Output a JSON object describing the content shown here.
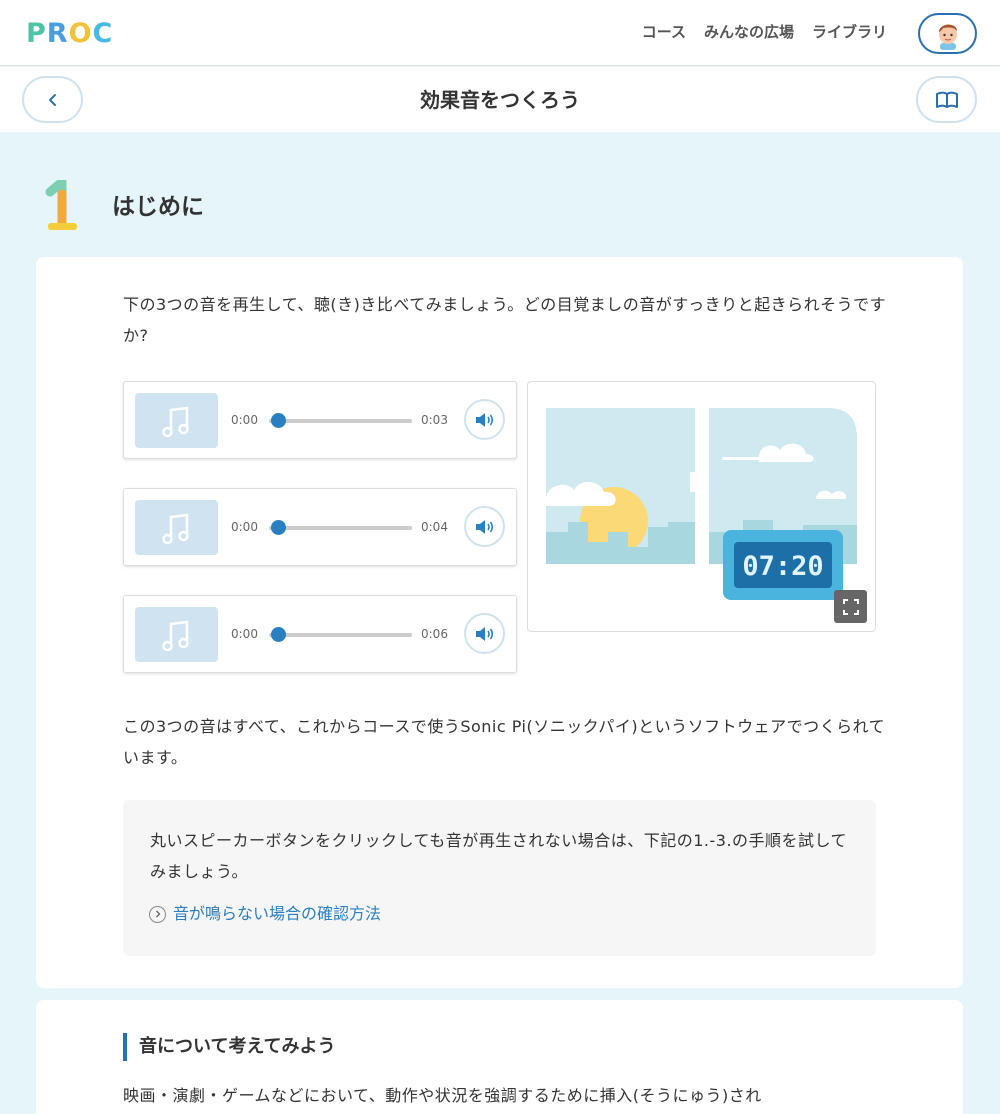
{
  "header": {
    "logo": [
      "P",
      "R",
      "O",
      "C"
    ],
    "logo_colors": [
      "#4fc3a8",
      "#4a9ee0",
      "#f3c23a",
      "#48b9e6"
    ],
    "nav": [
      "コース",
      "みんなの広場",
      "ライブラリ"
    ]
  },
  "subheader": {
    "title": "効果音をつくろう"
  },
  "section": {
    "number": "1",
    "title": "はじめに"
  },
  "intro": "下の3つの音を再生して、聴(き)き比べてみましょう。どの目覚ましの音がすっきりと起きられそうですか?",
  "players": [
    {
      "current": "0:00",
      "duration": "0:03"
    },
    {
      "current": "0:00",
      "duration": "0:04"
    },
    {
      "current": "0:00",
      "duration": "0:06"
    }
  ],
  "illustration": {
    "clock": "07:20"
  },
  "description": "この3つの音はすべて、これからコースで使うSonic Pi(ソニックパイ)というソフトウェアでつくられています。",
  "note": {
    "text": "丸いスピーカーボタンをクリックしても音が再生されない場合は、下記の1.-3.の手順を試してみましょう。",
    "link": "音が鳴らない場合の確認方法"
  },
  "section2": {
    "heading": "音について考えてみよう",
    "text": "映画・演劇・ゲームなどにおいて、動作や状況を強調するために挿入(そうにゅう)され"
  },
  "colors": {
    "accent": "#2a7fc0",
    "background": "#e6f5fa"
  }
}
